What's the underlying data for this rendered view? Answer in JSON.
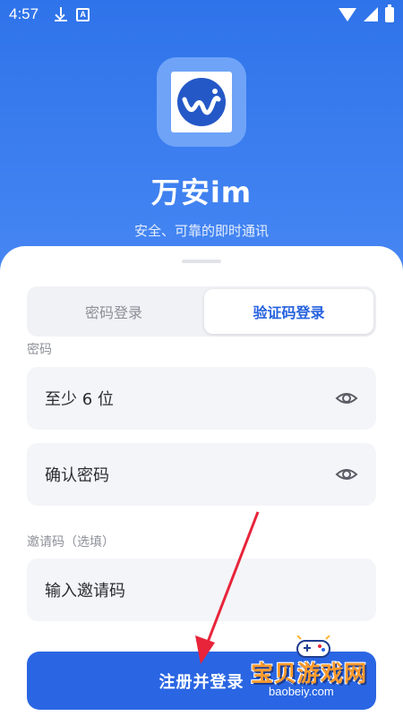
{
  "status_bar": {
    "time": "4:57",
    "icons": [
      "download-icon",
      "a-app-icon",
      "wifi-icon",
      "signal-icon",
      "battery-icon"
    ]
  },
  "app": {
    "title": "万安im",
    "subtitle": "安全、可靠的即时通讯"
  },
  "tabs": [
    {
      "label": "密码登录",
      "active": false
    },
    {
      "label": "验证码登录",
      "active": true
    }
  ],
  "form": {
    "password_label": "密码",
    "password_placeholder": "至少 6 位",
    "confirm_placeholder": "确认密码",
    "invite_label": "邀请码（选填）",
    "invite_placeholder": "输入邀请码",
    "submit_label": "注册并登录"
  },
  "watermark": {
    "title": "宝贝游戏网",
    "url": "baobeiy.com"
  },
  "colors": {
    "primary": "#2a66e3",
    "background": "#3b7cf0",
    "active_tab_text": "#2561df"
  }
}
